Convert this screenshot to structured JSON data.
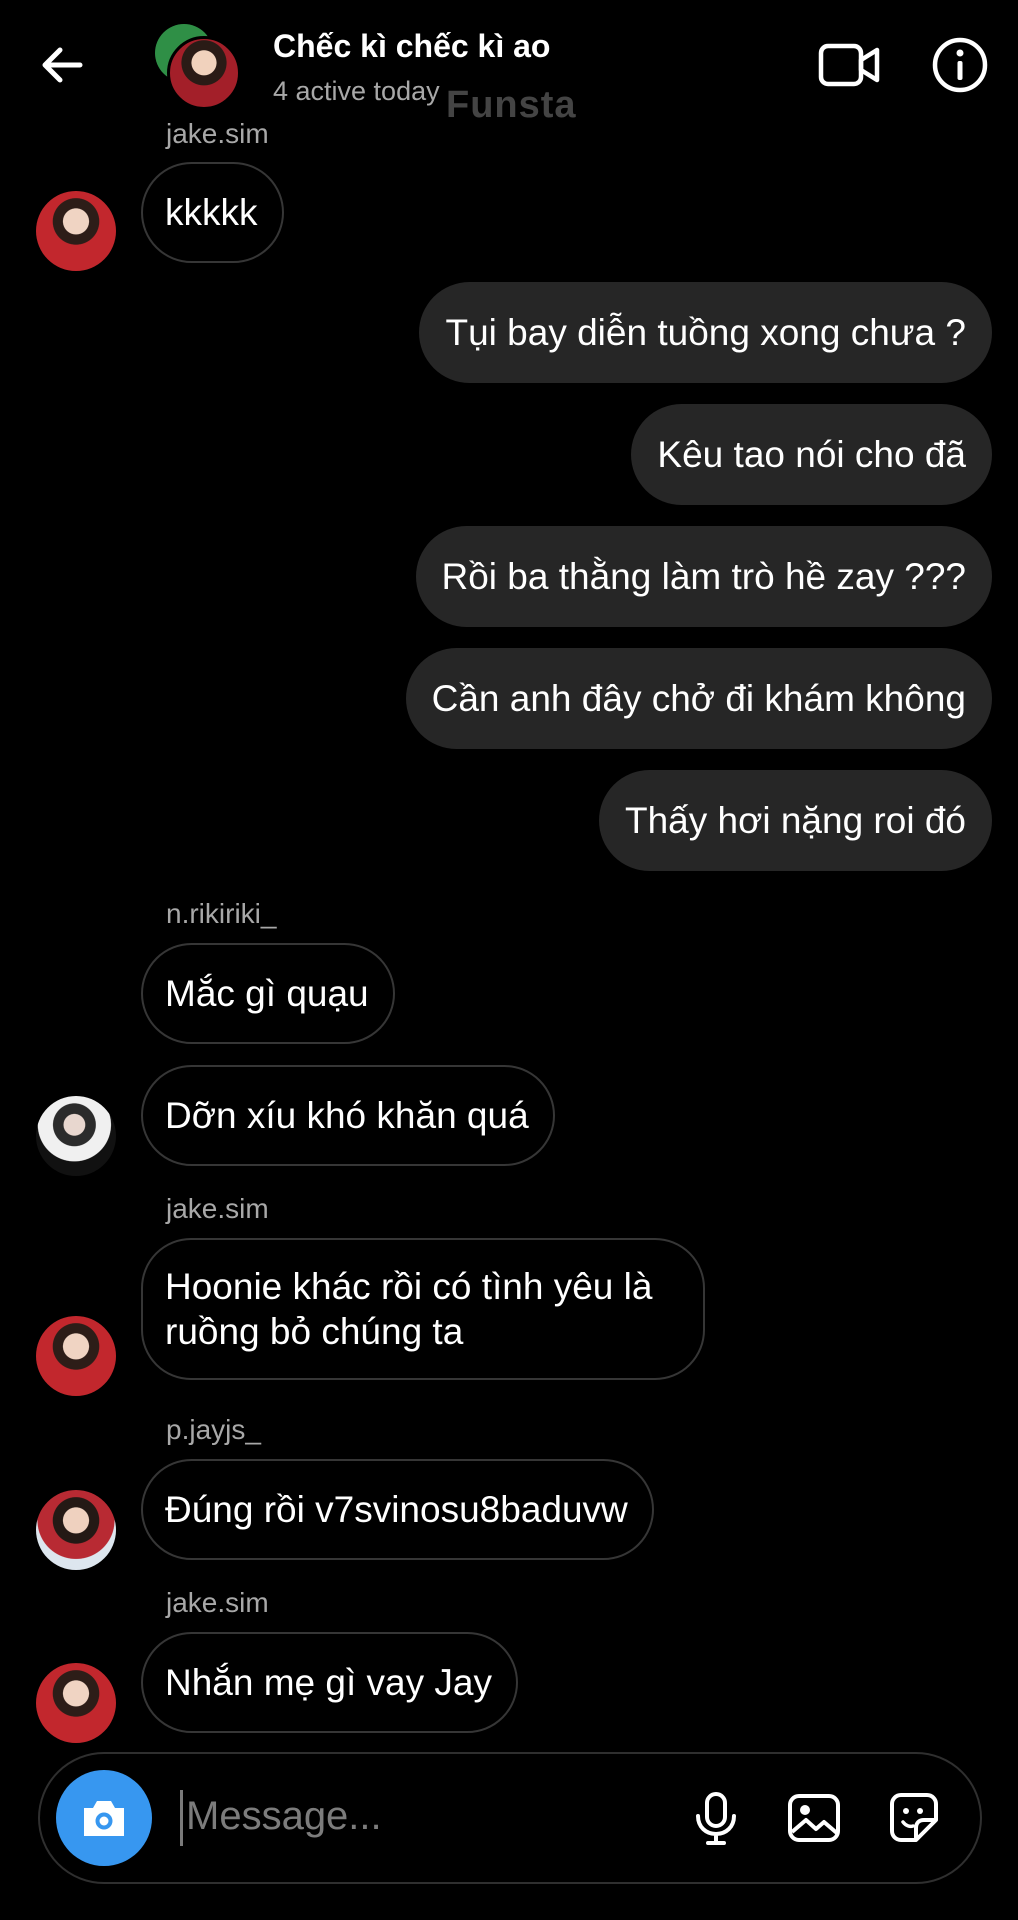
{
  "header": {
    "title": "Chếc kì chếc kì ao",
    "subtitle": "4 active today",
    "watermark": "Funsta",
    "icons": {
      "back": "arrow-left-icon",
      "video": "video-call-icon",
      "info": "info-icon"
    }
  },
  "messages": [
    {
      "type": "in",
      "sender": "jake.sim",
      "text": "kkkkk"
    },
    {
      "type": "out",
      "text": "Tụi bay diễn tuồng xong chưa ?"
    },
    {
      "type": "out",
      "text": "Kêu tao nói cho đã"
    },
    {
      "type": "out",
      "text": "Rồi ba thằng làm trò hề zay ???"
    },
    {
      "type": "out",
      "text": "Cần anh đây chở đi khám không"
    },
    {
      "type": "out",
      "text": "Thấy hơi nặng roi đó"
    },
    {
      "type": "in",
      "sender": "n.rikiriki_",
      "text": "Mắc gì quạu"
    },
    {
      "type": "in",
      "text": "Dỡn xíu khó khăn quá"
    },
    {
      "type": "in",
      "sender": "jake.sim",
      "text": "Hoonie khác rồi có tình yêu là ruồng bỏ chúng ta"
    },
    {
      "type": "in",
      "sender": "p.jayjs_",
      "text": "Đúng rồi v7svinosu8baduvw"
    },
    {
      "type": "in",
      "sender": "jake.sim",
      "text": "Nhắn mẹ gì vay Jay"
    }
  ],
  "composer": {
    "placeholder": "Message...",
    "icons": {
      "camera": "camera-icon",
      "mic": "microphone-icon",
      "gallery": "image-icon",
      "sticker": "sticker-icon"
    },
    "camera_color": "#3797f0"
  },
  "colors": {
    "background": "#000000",
    "outgoing_bubble": "#262626",
    "incoming_border": "#363636",
    "muted_text": "#a8a8a8"
  }
}
